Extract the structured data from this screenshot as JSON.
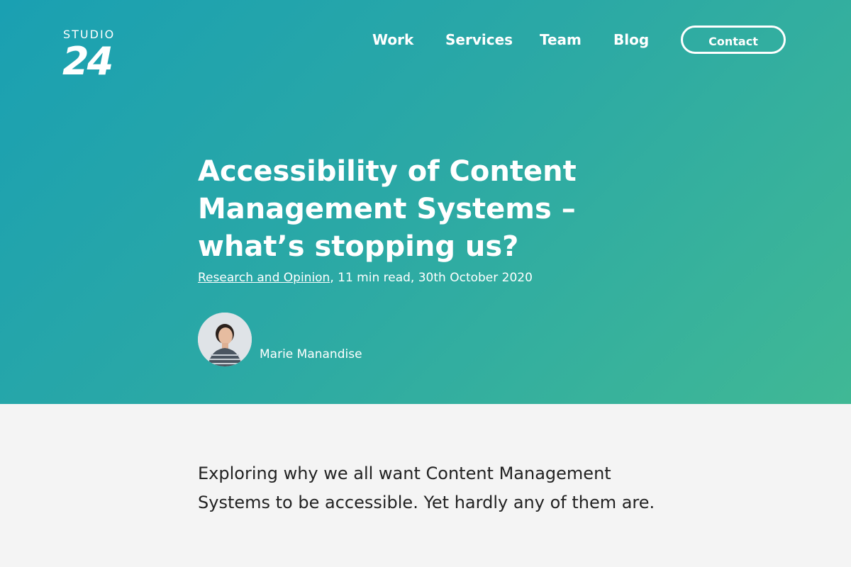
{
  "header": {
    "logo": {
      "top": "STUDIO",
      "bottom": "24"
    },
    "nav": [
      {
        "label": "Work"
      },
      {
        "label": "Services"
      },
      {
        "label": "Team"
      },
      {
        "label": "Blog"
      }
    ],
    "contact_label": "Contact"
  },
  "article": {
    "title": "Accessibility of Content Management Systems – what’s stopping us?",
    "category": "Research and Opinion",
    "meta_rest": ", 11 min read, 30th October 2020",
    "author": "Marie Manandise",
    "intro": "Exploring why we all want Content Management Systems to be accessible. Yet hardly any of them are."
  },
  "colors": {
    "gradient_start": "#1aa0b2",
    "gradient_end": "#40b895",
    "body_bg": "#f4f4f4",
    "text_dark": "#222222"
  }
}
